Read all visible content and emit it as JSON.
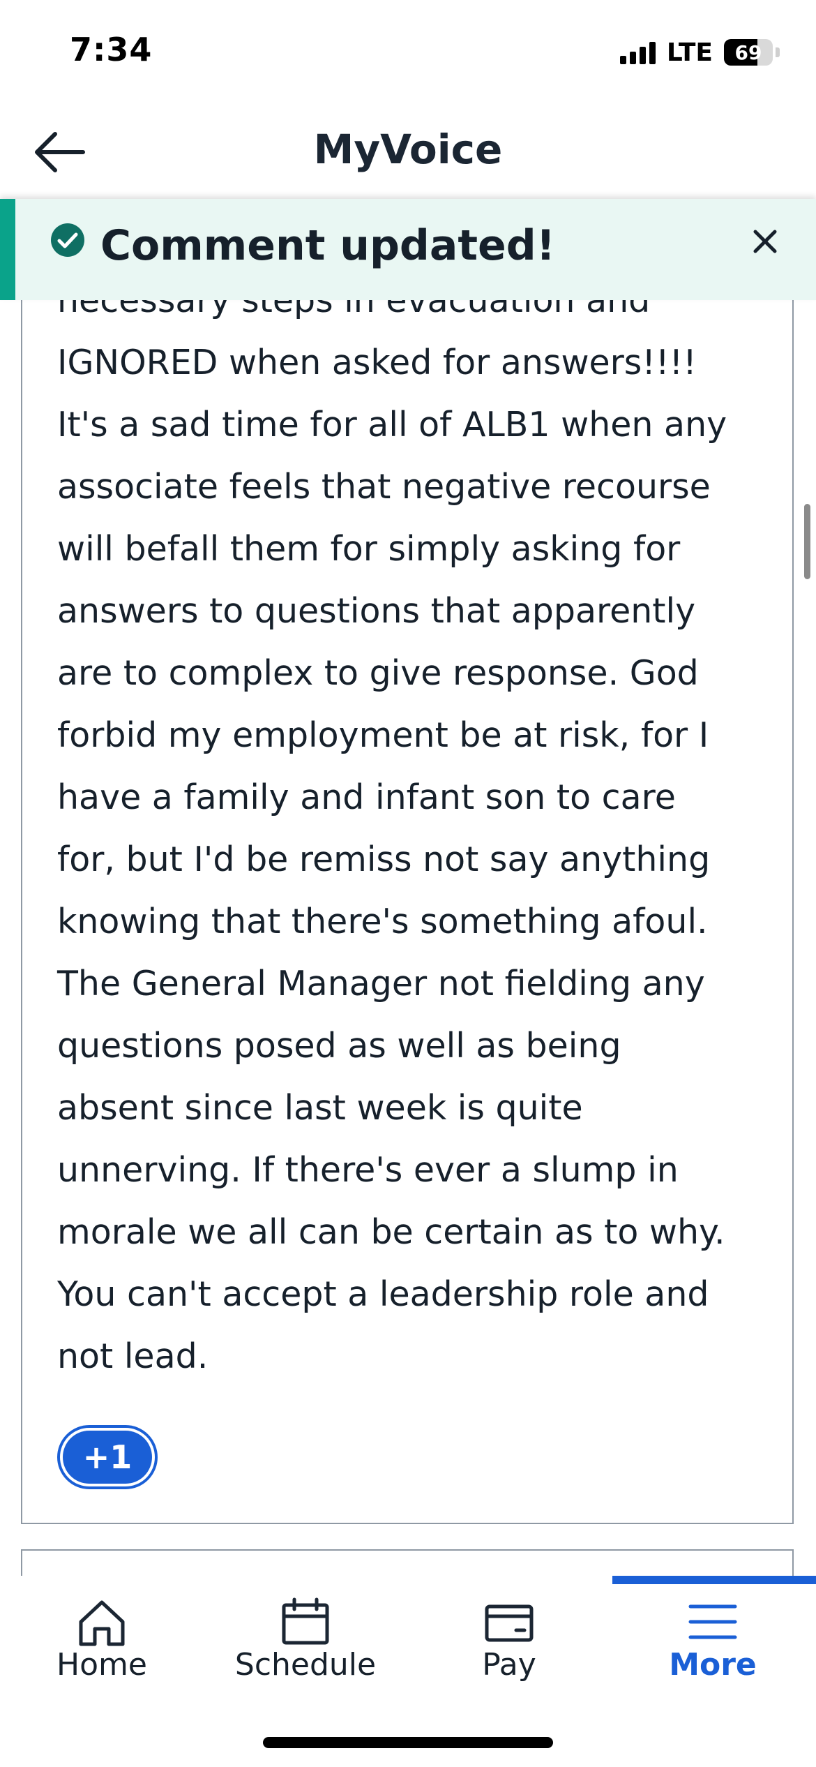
{
  "status_bar": {
    "time": "7:34",
    "network": "LTE",
    "battery_level": "69"
  },
  "header": {
    "title": "MyVoice"
  },
  "toast": {
    "message": "Comment updated!"
  },
  "comment": {
    "lines": [
      "necessary steps in evacuation and",
      "IGNORED when asked for answers!!!!",
      "It's a sad time for all of ALB1 when any",
      "associate feels that negative recourse",
      "will befall them for simply asking for",
      "answers to questions that apparently",
      "are to complex to give response. God",
      "forbid my employment be at risk, for I",
      "have a family and infant son to care",
      "for, but I'd be remiss not say anything",
      "knowing that there's something afoul.",
      "The General Manager not fielding any",
      "questions posed as well as being",
      "absent since last week is quite",
      "unnerving. If there's ever a slump in",
      "morale we all can be certain as to why.",
      "You can't accept a leadership role and",
      "not lead."
    ],
    "vote_label": "+1"
  },
  "nav": {
    "items": [
      {
        "label": "Home",
        "icon": "home-icon"
      },
      {
        "label": "Schedule",
        "icon": "calendar-icon"
      },
      {
        "label": "Pay",
        "icon": "wallet-icon"
      },
      {
        "label": "More",
        "icon": "menu-icon"
      }
    ],
    "active": "More"
  },
  "colors": {
    "accent": "#1a5fd6",
    "toast_background": "#e9f7f3",
    "toast_accent": "#0aa38a",
    "text": "#16202b"
  }
}
